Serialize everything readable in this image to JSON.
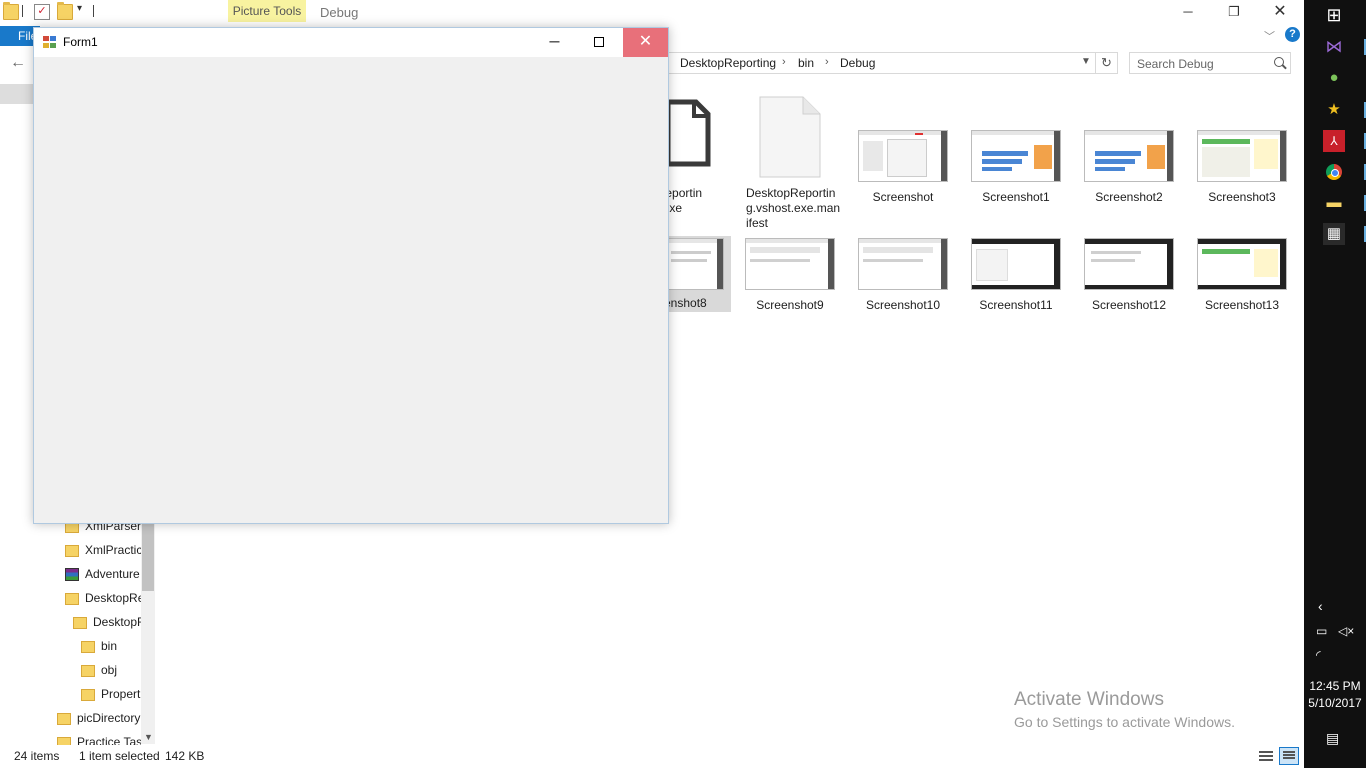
{
  "explorer": {
    "contextual_tab": "Picture Tools",
    "title": "Debug",
    "file_tab_label": "File",
    "help_label": "?",
    "breadcrumb": [
      "DesktopReporting",
      "bin",
      "Debug"
    ],
    "search_placeholder": "Search Debug",
    "files": [
      {
        "name": "DesktopReporting.vshost.exe",
        "display": "pReportin\nst.exe"
      },
      {
        "name": "DesktopReporting.vshost.exe.manifest",
        "display": "DesktopReportin\ng.vshost.exe.man\nifest"
      },
      {
        "name": "Screenshot"
      },
      {
        "name": "Screenshot1"
      },
      {
        "name": "Screenshot2"
      },
      {
        "name": "Screenshot3"
      },
      {
        "name": "Screenshot8",
        "display": "enshot8",
        "selected": true
      },
      {
        "name": "Screenshot9"
      },
      {
        "name": "Screenshot10"
      },
      {
        "name": "Screenshot11"
      },
      {
        "name": "Screenshot12"
      },
      {
        "name": "Screenshot13"
      }
    ],
    "tree": [
      {
        "label": "XmlParser",
        "icon": "folder"
      },
      {
        "label": "XmlPractic",
        "icon": "folder"
      },
      {
        "label": "Adventure",
        "icon": "archive"
      },
      {
        "label": "DesktopRe",
        "icon": "folder"
      },
      {
        "label": "DesktopR",
        "icon": "folder"
      },
      {
        "label": "bin",
        "icon": "folder"
      },
      {
        "label": "obj",
        "icon": "folder"
      },
      {
        "label": "Propert",
        "icon": "folder"
      },
      {
        "label": "picDirectory",
        "icon": "folder"
      },
      {
        "label": "Practice Tas",
        "icon": "folder"
      }
    ],
    "status": {
      "item_count": "24 items",
      "selection": "1 item selected",
      "size": "142 KB"
    },
    "watermark": {
      "title": "Activate Windows",
      "subtitle": "Go to Settings to activate Windows."
    }
  },
  "form1": {
    "title": "Form1"
  },
  "taskbar": {
    "time": "12:45 PM",
    "date": "5/10/2017"
  },
  "colors": {
    "accent": "#1979ca",
    "close_hover": "#e8707a",
    "contextual_tab": "#f8f3a0",
    "taskbar": "#101010"
  }
}
